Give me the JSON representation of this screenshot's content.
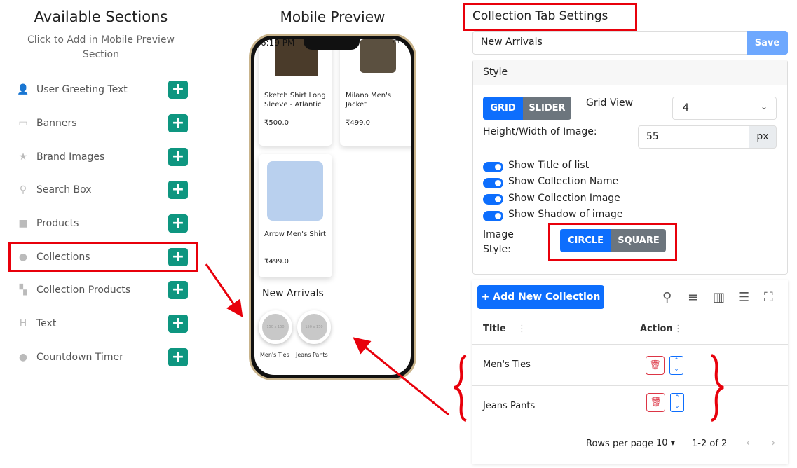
{
  "left": {
    "title": "Available Sections",
    "subtitle": "Click to Add in Mobile Preview Section",
    "items": [
      {
        "label": "User Greeting Text",
        "icon": "user-icon"
      },
      {
        "label": "Banners",
        "icon": "images-icon"
      },
      {
        "label": "Brand Images",
        "icon": "star-icon"
      },
      {
        "label": "Search Box",
        "icon": "search-icon"
      },
      {
        "label": "Products",
        "icon": "box-icon"
      },
      {
        "label": "Collections",
        "icon": "fire-icon"
      },
      {
        "label": "Collection Products",
        "icon": "boxes-icon"
      },
      {
        "label": "Text",
        "icon": "heading-icon"
      },
      {
        "label": "Countdown Timer",
        "icon": "fire-icon"
      }
    ],
    "plus": "+"
  },
  "preview": {
    "title": "Mobile Preview",
    "time": "6:19 PM",
    "products": [
      {
        "name": "Sketch Shirt Long Sleeve - Atlantic",
        "price": "₹500.0"
      },
      {
        "name": "Milano Men's Jacket",
        "price": "₹499.0"
      },
      {
        "name": "Arrow Men's Shirt",
        "price": "₹499.0"
      }
    ],
    "section_title": "New Arrivals",
    "collections": [
      "Men's Ties",
      "Jeans Pants"
    ],
    "placeholder": "150 x 150"
  },
  "settings": {
    "title": "Collection Tab Settings",
    "name_value": "New Arrivals",
    "save": "Save",
    "style_header": "Style",
    "grid": "GRID",
    "slider": "SLIDER",
    "grid_view_label": "Grid View",
    "grid_view_value": "4",
    "hw_label": "Height/Width of Image:",
    "hw_value": "55",
    "hw_unit": "px",
    "toggles": [
      {
        "label": "Show Title of list",
        "on": true
      },
      {
        "label": "Show Collection Name",
        "on": true
      },
      {
        "label": "Show Collection Image",
        "on": true
      },
      {
        "label": "Show Shadow of image",
        "on": true
      }
    ],
    "image_style_label1": "Image",
    "image_style_label2": "Style:",
    "circle": "CIRCLE",
    "square": "SQUARE"
  },
  "table": {
    "add": "+ Add New Collection",
    "columns": [
      "Title",
      "Action"
    ],
    "rows": [
      "Men's Ties",
      "Jeans Pants"
    ],
    "rows_per_page_label": "Rows per page",
    "rows_per_page": "10",
    "range": "1-2 of 2"
  },
  "colors": {
    "accent": "#0d6efd",
    "add_green": "#0e9680",
    "annotation": "#e8000b",
    "secondary": "#6c757d"
  }
}
